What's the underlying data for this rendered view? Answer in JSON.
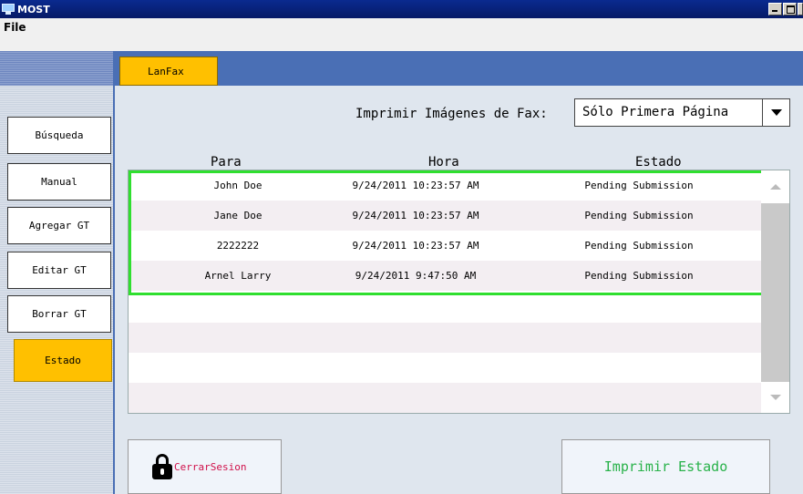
{
  "window": {
    "title": "MOST",
    "icon": "monitor-icon"
  },
  "menu": {
    "file": "File"
  },
  "sidebar": {
    "items": [
      {
        "label": "Búsqueda",
        "active": false
      },
      {
        "label": "Manual",
        "active": false
      },
      {
        "label": "Agregar GT",
        "active": false
      },
      {
        "label": "Editar GT",
        "active": false
      },
      {
        "label": "Borrar GT",
        "active": false
      },
      {
        "label": "Estado",
        "active": true
      }
    ]
  },
  "tab": {
    "label": "LanFax"
  },
  "print_images": {
    "label": "Imprimir Imágenes de Fax:",
    "selected": "Sólo Primera Página"
  },
  "table": {
    "columns": [
      "Para",
      "Hora",
      "Estado"
    ],
    "rows": [
      {
        "para": "John Doe",
        "hora": "9/24/2011 10:23:57 AM",
        "estado": "Pending Submission"
      },
      {
        "para": "Jane Doe",
        "hora": "9/24/2011 10:23:57 AM",
        "estado": "Pending Submission"
      },
      {
        "para": "2222222",
        "hora": "9/24/2011 10:23:57 AM",
        "estado": "Pending Submission"
      },
      {
        "para": "Arnel Larry",
        "hora": "9/24/2011 9:47:50 AM",
        "estado": "Pending Submission"
      }
    ]
  },
  "buttons": {
    "logout": "CerrarSesion",
    "print_status": "Imprimir Estado"
  },
  "colors": {
    "accent": "#ffc000",
    "band": "#4a6fb5",
    "selection": "#2fdf2f",
    "logout_text": "#d0104a",
    "print_text": "#29b24a"
  }
}
